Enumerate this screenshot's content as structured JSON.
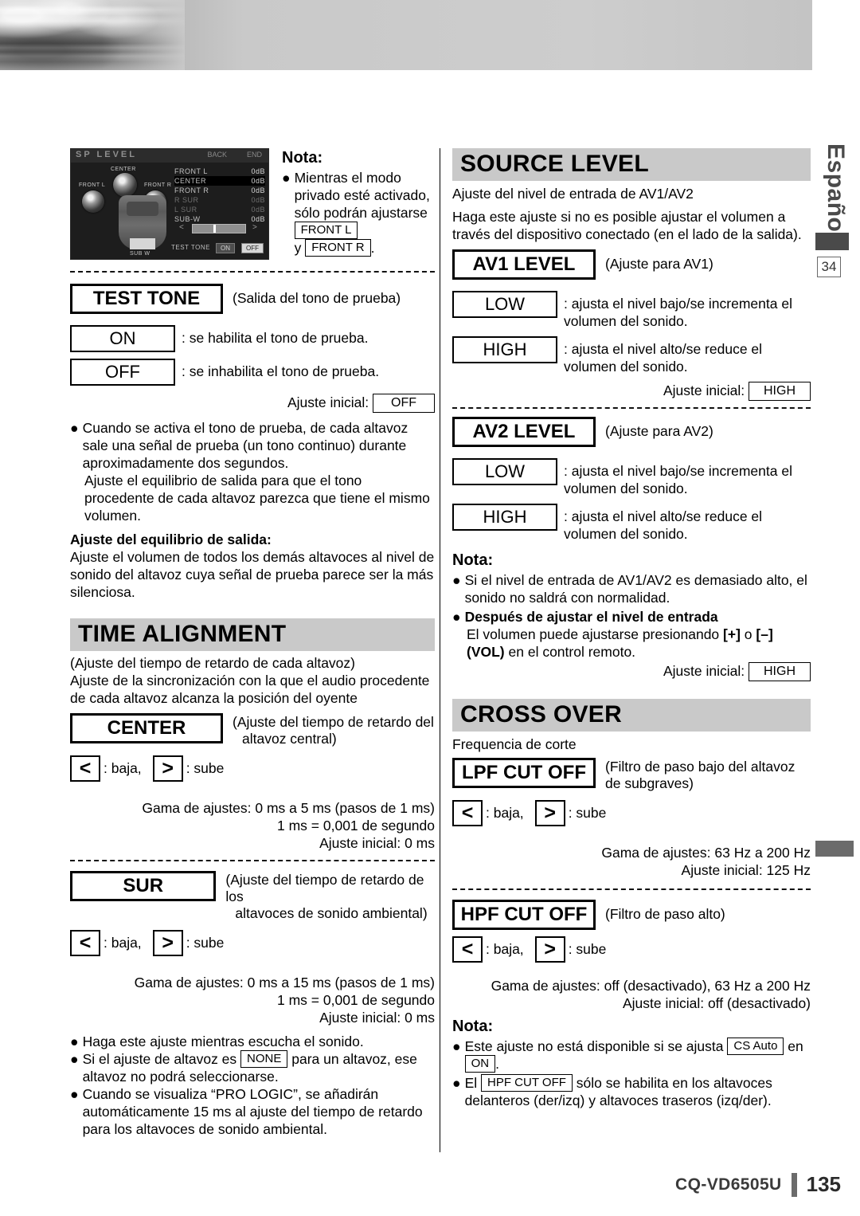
{
  "page": {
    "language_tab": "Español",
    "chapter_marker": "34",
    "footer_model": "CQ-VD6505U",
    "footer_page": "135"
  },
  "lcd": {
    "title": "SP LEVEL",
    "back": "BACK",
    "end": "END",
    "center_label": "CENTER",
    "front_l_label": "FRONT L",
    "front_r_label": "FRONT R",
    "sub_label": "SUB W",
    "rows": [
      {
        "name": "FRONT  L",
        "val": "0dB"
      },
      {
        "name": "CENTER",
        "val": "0dB"
      },
      {
        "name": "FRONT  R",
        "val": "0dB"
      },
      {
        "name": "R  SUR",
        "val": "0dB"
      },
      {
        "name": "L  SUR",
        "val": "0dB"
      },
      {
        "name": "SUB-W",
        "val": "0dB"
      }
    ],
    "test_tone_label": "TEST TONE",
    "btn_on": "ON",
    "btn_off": "OFF",
    "arrow_left": "<",
    "arrow_right": ">"
  },
  "left": {
    "nota_heading": "Nota:",
    "nota_bullet_pre": "Mientras el modo privado esté activa­do, sólo podrán ajustarse",
    "nota_key1": "FRONT L",
    "nota_mid": "y",
    "nota_key2": "FRONT R",
    "nota_end": ".",
    "test_tone": {
      "key": "TEST TONE",
      "caption": "(Salida del tono de prueba)",
      "on_key": "ON",
      "on_desc": ": se habilita el tono de prueba.",
      "off_key": "OFF",
      "off_desc": ": se inhabilita el tono de prueba.",
      "initial_label": "Ajuste inicial:",
      "initial_value": "OFF",
      "bullet": "Cuando se activa el tono de prueba, de cada altavoz sale una señal de prueba (un tono continuo) durante aproxi­madamente dos segundos.",
      "bullet_cont": "Ajuste el equilibrio de salida para que el tono procedente de cada altavoz parezca que tiene el mismo volumen.",
      "balance_heading": "Ajuste del equilibrio de salida:",
      "balance_body": "Ajuste el volumen de todos los demás altavoces al nivel de sonido del altavoz cuya señal de prueba parece ser la más silenciosa."
    },
    "time_alignment": {
      "banner": "TIME ALIGNMENT",
      "sub1": "(Ajuste del tiempo de retardo de cada altavoz)",
      "sub2": "Ajuste de la sincronización con la que el audio procedente de cada altavoz alcanza la posición del oyente",
      "center_key": "CENTER",
      "center_caption_l1": "(Ajuste del tiempo de retardo del",
      "center_caption_l2": "altavoz central)",
      "arrow_left": "<",
      "arrow_left_desc": ": baja,",
      "arrow_right": ">",
      "arrow_right_desc": ": sube",
      "center_range": "Gama de ajustes: 0 ms a 5 ms (pasos de 1 ms)",
      "center_ms": "1 ms = 0,001 de segundo",
      "center_initial": "Ajuste inicial: 0 ms",
      "sur_key": "SUR",
      "sur_caption_l1": "(Ajuste del tiempo de retardo de los",
      "sur_caption_l2": "altavoces de sonido ambiental)",
      "sur_range": "Gama de ajustes: 0 ms a 15 ms (pasos de 1 ms)",
      "sur_ms": "1 ms = 0,001 de segundo",
      "sur_initial": "Ajuste inicial: 0 ms",
      "notes": [
        {
          "pre": "Haga este ajuste mientras escucha el sonido.",
          "key": "",
          "post": ""
        },
        {
          "pre": "Si el ajuste de altavoz es",
          "key": "NONE",
          "post": "para un altavoz, ese altavoz no podrá seleccionarse."
        },
        {
          "pre": "Cuando se visualiza “PRO LOGIC”, se añadirán automáticamente 15 ms al ajuste del tiempo de retardo para los altavoces de sonido ambiental.",
          "key": "",
          "post": ""
        }
      ]
    }
  },
  "right": {
    "source_level": {
      "banner": "SOURCE LEVEL",
      "sub1": "Ajuste del nivel de entrada de AV1/AV2",
      "sub2": "Haga este ajuste si no es posible ajustar el volumen a través del dispositivo conectado (en el lado de la salida).",
      "av1_key": "AV1 LEVEL",
      "av1_caption": "(Ajuste para AV1)",
      "low_key": "LOW",
      "low_desc": ": ajusta el nivel bajo/se incrementa el volu­men del sonido.",
      "high_key": "HIGH",
      "high_desc": ": ajusta el nivel alto/se reduce el volumen del sonido.",
      "initial_label": "Ajuste inicial:",
      "initial_value": "HIGH",
      "av2_key": "AV2 LEVEL",
      "av2_caption": "(Ajuste para AV2)",
      "nota_heading": "Nota:",
      "nota_b1": "Si el nivel de entrada de AV1/AV2 es demasiado alto, el sonido no saldrá con normalidad.",
      "nota_b2_bold": "Después de ajustar el nivel de entrada",
      "nota_b2_pre": "El volumen puede ajustarse presionando",
      "nota_b2_key1": "[+]",
      "nota_b2_mid": "o",
      "nota_b2_key2": "[–]",
      "nota_b2_key3": "(VOL)",
      "nota_b2_post": "en el control remoto.",
      "initial2_label": "Ajuste inicial:",
      "initial2_value": "HIGH"
    },
    "cross_over": {
      "banner": "CROSS OVER",
      "sub1": "Frequencia de corte",
      "lpf_key": "LPF CUT OFF",
      "lpf_caption_l1": "(Filtro de paso bajo del altavoz",
      "lpf_caption_l2": "de subgraves)",
      "arrow_left": "<",
      "arrow_left_desc": ": baja,",
      "arrow_right": ">",
      "arrow_right_desc": ": sube",
      "lpf_range": "Gama de ajustes: 63 Hz a 200 Hz",
      "lpf_initial": "Ajuste inicial: 125 Hz",
      "hpf_key": "HPF CUT OFF",
      "hpf_caption": "(Filtro de paso alto)",
      "hpf_range": "Gama de ajustes: off (desactivado), 63 Hz a 200 Hz",
      "hpf_initial": "Ajuste inicial: off (desactivado)",
      "nota_heading": "Nota:",
      "nota_b1_pre": "Este ajuste no está disponible si se ajusta",
      "nota_b1_key": "CS Auto",
      "nota_b1_mid": "en",
      "nota_b1_key2": "ON",
      "nota_b1_post": ".",
      "nota_b2_pre": "El",
      "nota_b2_key": "HPF CUT OFF",
      "nota_b2_post": "sólo se habilita en los altavoces delanteros (der/izq) y altavoces traseros (izq/der)."
    }
  }
}
